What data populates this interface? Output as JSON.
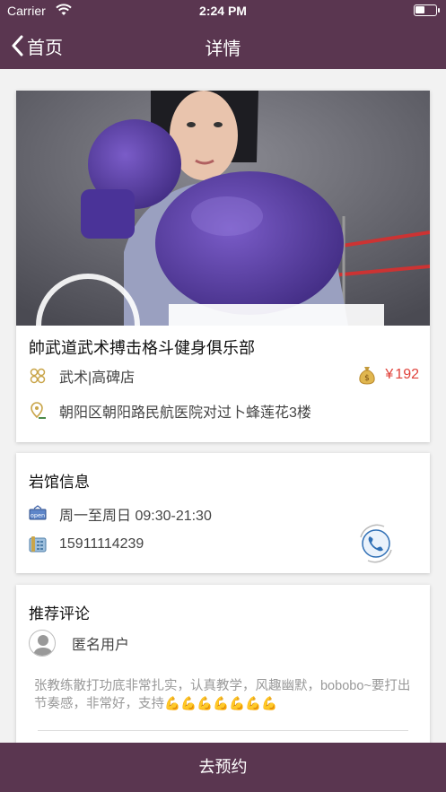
{
  "status_bar": {
    "carrier": "Carrier",
    "time": "2:24 PM"
  },
  "nav": {
    "back_label": "首页",
    "title": "详情"
  },
  "gym": {
    "name": "帥武道武术搏击格斗健身俱乐部",
    "category": "武术|高碑店",
    "price_symbol": "¥",
    "price": "192",
    "address": "朝阳区朝阳路民航医院对过卜蜂莲花3楼"
  },
  "venue_info": {
    "title": "岩馆信息",
    "hours": "周一至周日 09:30-21:30",
    "phone": "15911114239"
  },
  "reviews": {
    "title": "推荐评论",
    "items": [
      {
        "user": "匿名用户",
        "text": "张教练散打功底非常扎实，认真教学，风趣幽默，bobobo~要打出节奏感，非常好，支持💪💪💪💪💪💪💪"
      }
    ]
  },
  "bottom_button": {
    "label": "去预约"
  },
  "colors": {
    "theme": "#5a3650",
    "price": "#e0413a",
    "glove": "#5b3fa8"
  },
  "icons": {
    "back": "chevron-left-icon",
    "category": "category-grid-icon",
    "price": "money-bag-icon",
    "location": "location-pin-icon",
    "hours": "open-sign-icon",
    "phone": "telephone-icon",
    "call": "phone-call-icon",
    "avatar": "user-avatar-icon"
  }
}
